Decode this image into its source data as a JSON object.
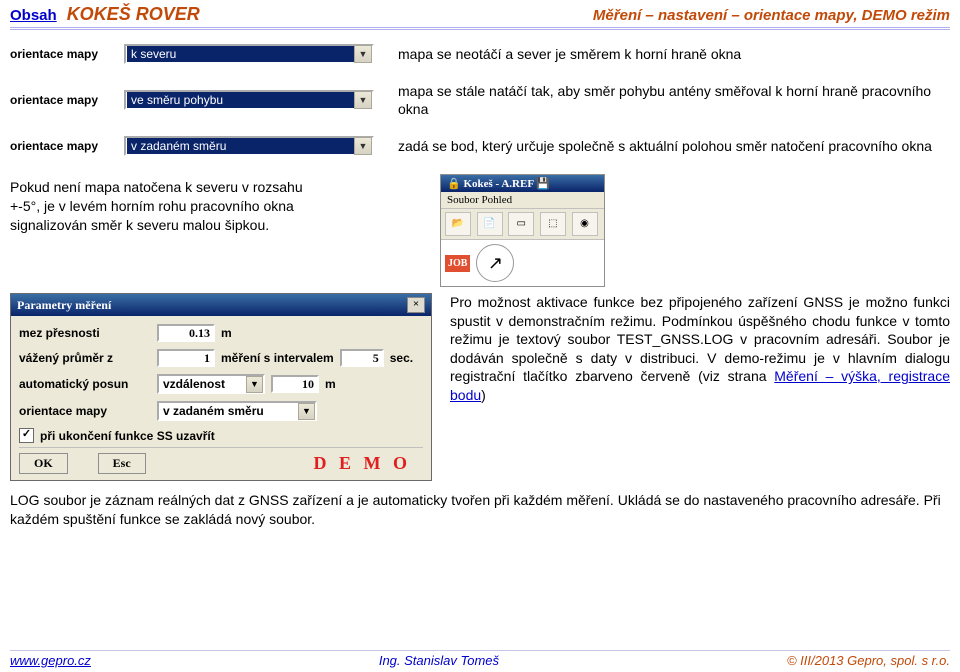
{
  "header": {
    "obsah": "Obsah",
    "kokes": "KOKEŠ ROVER",
    "right": "Měření – nastavení – orientace mapy, DEMO režim"
  },
  "combos": {
    "field_label": "orientace mapy",
    "row1": {
      "value": "k severu",
      "desc": "mapa se neotáčí a sever je směrem k horní hraně okna"
    },
    "row2": {
      "value": "ve směru pohybu",
      "desc": "mapa se stále natáčí tak, aby směr pohybu antény směřoval k horní hraně pracovního okna"
    },
    "row3": {
      "value": "v zadaném směru",
      "desc": "zadá se bod, který určuje společně s aktuální polohou směr natočení pracovního okna"
    }
  },
  "after": "Pokud není mapa natočena k severu v rozsahu +-5°, je v levém horním rohu pracovního okna signalizován směr k severu malou šipkou.",
  "kokesbar": {
    "title": "Kokeš - A.REF",
    "menu": "Soubor  Pohled",
    "job": "JOB"
  },
  "pm": {
    "title": "Parametry měření",
    "rows": {
      "accuracy_label": "mez přesnosti",
      "accuracy_value": "0.13",
      "accuracy_unit": "m",
      "weight_label": "vážený průměr z",
      "weight_value": "1",
      "weight_mid": "měření s intervalem",
      "weight_sec": "5",
      "weight_unit": "sec.",
      "auto_label": "automatický posun",
      "auto_sel": "vzdálenost",
      "auto_val": "10",
      "auto_unit": "m",
      "orient_label": "orientace mapy",
      "orient_sel": "v zadaném směru",
      "chk_label": "při ukončení funkce SS uzavřít"
    },
    "ok": "OK",
    "esc": "Esc",
    "demo": "D E M O"
  },
  "rightpara": {
    "text": "Pro možnost aktivace funkce bez připojeného zařízení GNSS je možno funkci spustit v demonstračním režimu. Podmínkou úspěšného chodu funkce v tomto režimu je textový soubor TEST_GNSS.LOG v pracovním adresáři. Soubor je dodáván společně s daty v distribuci. V demo-režimu je v hlavním dialogu registrační tlačítko zbarveno červeně (viz strana ",
    "link": "Měření – výška, registrace bodu",
    "tail": ")"
  },
  "lognote": "LOG soubor je záznam reálných dat z GNSS zařízení a je automaticky tvořen při každém měření. Ukládá se do nastaveného pracovního adresáře. Při každém spuštění funkce se zakládá nový soubor.",
  "footer": {
    "l": "www.gepro.cz",
    "c": "Ing. Stanislav Tomeš",
    "r": "© III/2013 Gepro, spol. s r.o."
  }
}
